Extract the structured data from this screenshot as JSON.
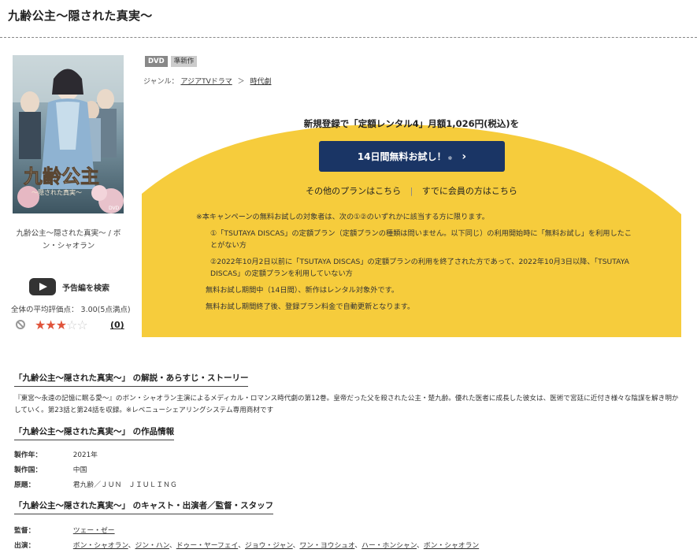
{
  "page": {
    "title": "九齢公主〜隠された真実〜"
  },
  "left": {
    "jacket_title": "九齢公主",
    "jacket_subtitle": "〜隠された真実〜",
    "caption": "九齢公主〜隠された真実〜 / ボン・シャオラン",
    "trailer_label": "予告編を検索",
    "avg_rating": "全体の平均評価点： 3.00(5点満点)",
    "rating_stars": 3,
    "rating_max": 5,
    "review_count": "(0)"
  },
  "product": {
    "badge_dvd": "DVD",
    "badge_new": "準新作",
    "genre_label": "ジャンル：",
    "genre_1": "アジアTVドラマ",
    "genre_sep": "＞",
    "genre_2": "時代劇"
  },
  "promo": {
    "headline": "新規登録で「定額レンタル4」月額1,026円(税込)を",
    "trial_button": "14日間無料お試し！",
    "trial_button_mark": "※",
    "other_plans": "その他のプランはこちら",
    "member_link": "すでに会員の方はこちら",
    "note_1": "※本キャンペーンの無料お試しの対象者は、次の①②のいずれかに該当する方に限ります。",
    "note_2": "①「TSUTAYA DISCAS」の定額プラン（定額プランの種類は問いません。以下同じ）の利用開始時に「無料お試し」を利用したことがない方",
    "note_3": "②2022年10月2日以前に「TSUTAYA DISCAS」の定額プランの利用を終了された方であって、2022年10月3日以降、「TSUTAYA DISCAS」の定額プランを利用していない方",
    "note_4": "無料お試し期間中（14日間）、新作はレンタル対象外です。",
    "note_5": "無料お試し期間終了後、登録プラン料金で自動更新となります。",
    "bg_color": "#f6cc3c",
    "button_color": "#1a3565"
  },
  "synopsis": {
    "heading": "「九齢公主〜隠された真実〜」 の解説・あらすじ・ストーリー",
    "text": "『東宮〜永遠の記憶に眠る愛〜』のボン・シャオラン主演によるメディカル・ロマンス時代劇の第12巻。皇帝だった父を殺された公主・楚九齢。優れた医者に成長した彼女は、医術で宮廷に近付き様々な陰謀を解き明かしていく。第23話と第24話を収録。※レベニューシェアリングシステム専用商材です"
  },
  "work_info": {
    "heading": "「九齢公主〜隠された真実〜」 の作品情報",
    "year_label": "製作年：",
    "year": "2021年",
    "country_label": "製作国：",
    "country": "中国",
    "original_label": "原題：",
    "original": "君九齢／ＪＵＮ　ＪＩＵＬＩＮＧ"
  },
  "cast": {
    "heading": "「九齢公主〜隠された真実〜」 のキャスト・出演者／監督・スタッフ",
    "director_label": "監督：",
    "director": "ツェー・ゼー",
    "cast_label": "出演：",
    "members": [
      "ボン・シャオラン",
      "ジン・ハン",
      "ドゥー・ヤーフェイ",
      "ジョウ・ジャン",
      "ワン・ヨウシュオ",
      "ハー・ホンシャン",
      "ボン・シャオラン"
    ]
  }
}
